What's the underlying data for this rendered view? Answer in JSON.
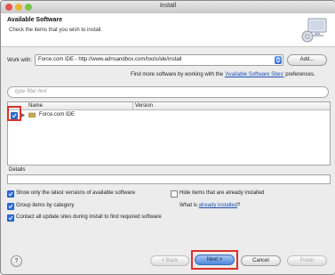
{
  "window": {
    "title": "Install"
  },
  "header": {
    "title": "Available Software",
    "description": "Check the items that you wish to install."
  },
  "work_with": {
    "label": "Work with:",
    "value": "Force.com IDE - http://www.adnsandbox.com/tools/ide/install",
    "add_label": "Add...",
    "more_text_prefix": "Find more software by working with the ",
    "more_link": "'Available Software Sites'",
    "more_text_suffix": " preferences."
  },
  "filter": {
    "placeholder": "type filter text"
  },
  "table": {
    "columns": [
      "Name",
      "Version"
    ],
    "rows": [
      {
        "name": "Force.com IDE",
        "version": "",
        "checked": true
      }
    ]
  },
  "details": {
    "label": "Details"
  },
  "options": {
    "latest": "Show only the latest versions of available software",
    "hide_installed": "Hide items that are already installed",
    "group": "Group items by category",
    "what_is": "What is ",
    "already_installed_link": "already installed",
    "what_is_suffix": "?",
    "contact_sites": "Contact all update sites during install to find required software"
  },
  "footer": {
    "help_icon_glyph": "?",
    "back": "< Back",
    "next": "Next >",
    "cancel": "Cancel",
    "finish": "Finish"
  },
  "colors": {
    "accent": "#2f6fd8",
    "highlight": "#d9322b"
  }
}
